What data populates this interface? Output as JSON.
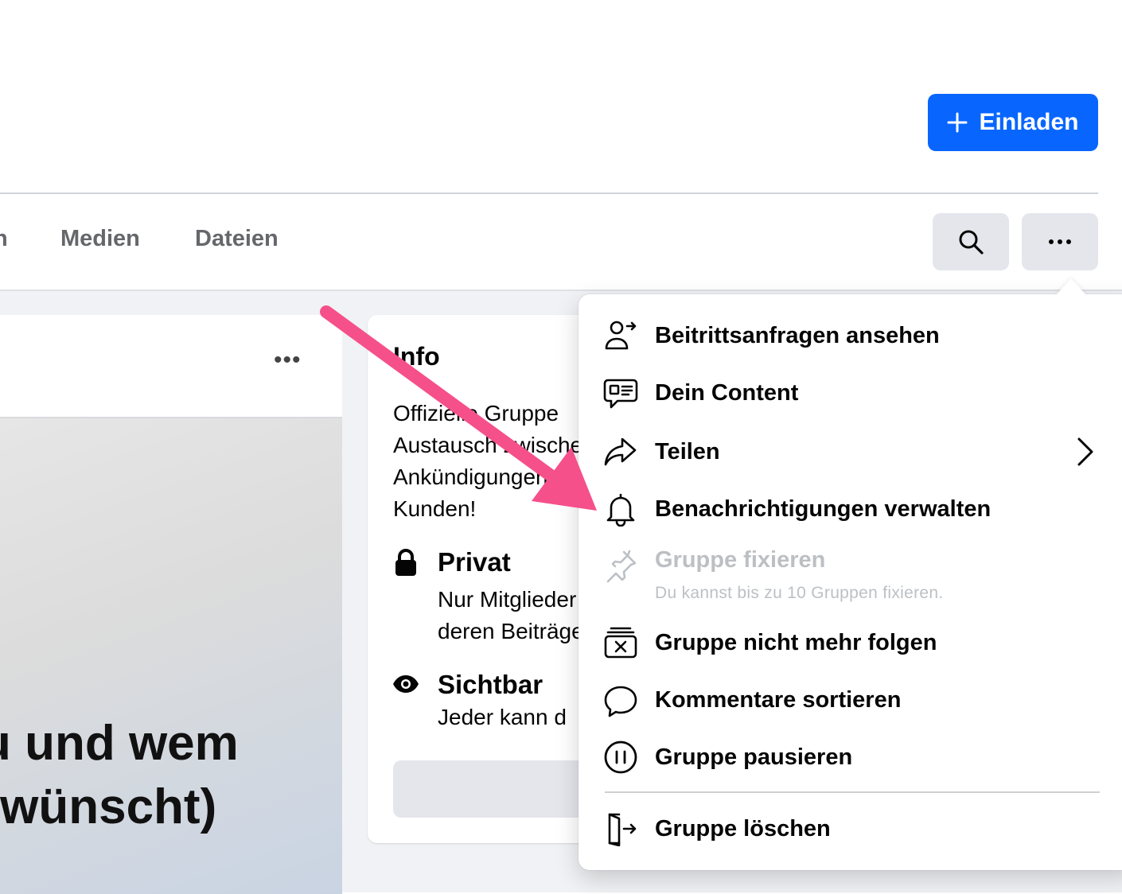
{
  "header": {
    "invite_label": "Einladen"
  },
  "tabs": [
    {
      "label": "n"
    },
    {
      "label": "Medien"
    },
    {
      "label": "Dateien"
    }
  ],
  "post": {
    "more_label": "•••",
    "headline": "u und wem\nrwünscht)"
  },
  "info": {
    "title": "Info",
    "description_lines": [
      "Offizielle Gruppe",
      "Austausch zwischen",
      "Ankündigungen",
      "Kunden!"
    ],
    "privacy_title": "Privat",
    "privacy_lines": [
      "Nur Mitglieder",
      "deren Beiträge"
    ],
    "visibility_title": "Sichtbar",
    "visibility_text": "Jeder kann d"
  },
  "menu": {
    "items": [
      {
        "label": "Beitrittsanfragen ansehen",
        "icon": "person-add-icon"
      },
      {
        "label": "Dein Content",
        "icon": "content-icon"
      },
      {
        "label": "Teilen",
        "icon": "share-icon"
      },
      {
        "label": "Benachrichtigungen verwalten",
        "icon": "bell-icon"
      },
      {
        "label": "Gruppe fixieren",
        "sublabel": "Du kannst bis zu 10 Gruppen fixieren.",
        "icon": "pin-icon",
        "disabled": true
      },
      {
        "label": "Gruppe nicht mehr folgen",
        "icon": "unfollow-icon"
      },
      {
        "label": "Kommentare sortieren",
        "icon": "comment-icon"
      },
      {
        "label": "Gruppe pausieren",
        "icon": "pause-icon"
      },
      {
        "label": "Gruppe löschen",
        "icon": "leave-icon"
      }
    ]
  },
  "colors": {
    "accent": "#0866ff",
    "arrow": "#f5508a",
    "disabled_text": "#bcc0c4"
  }
}
